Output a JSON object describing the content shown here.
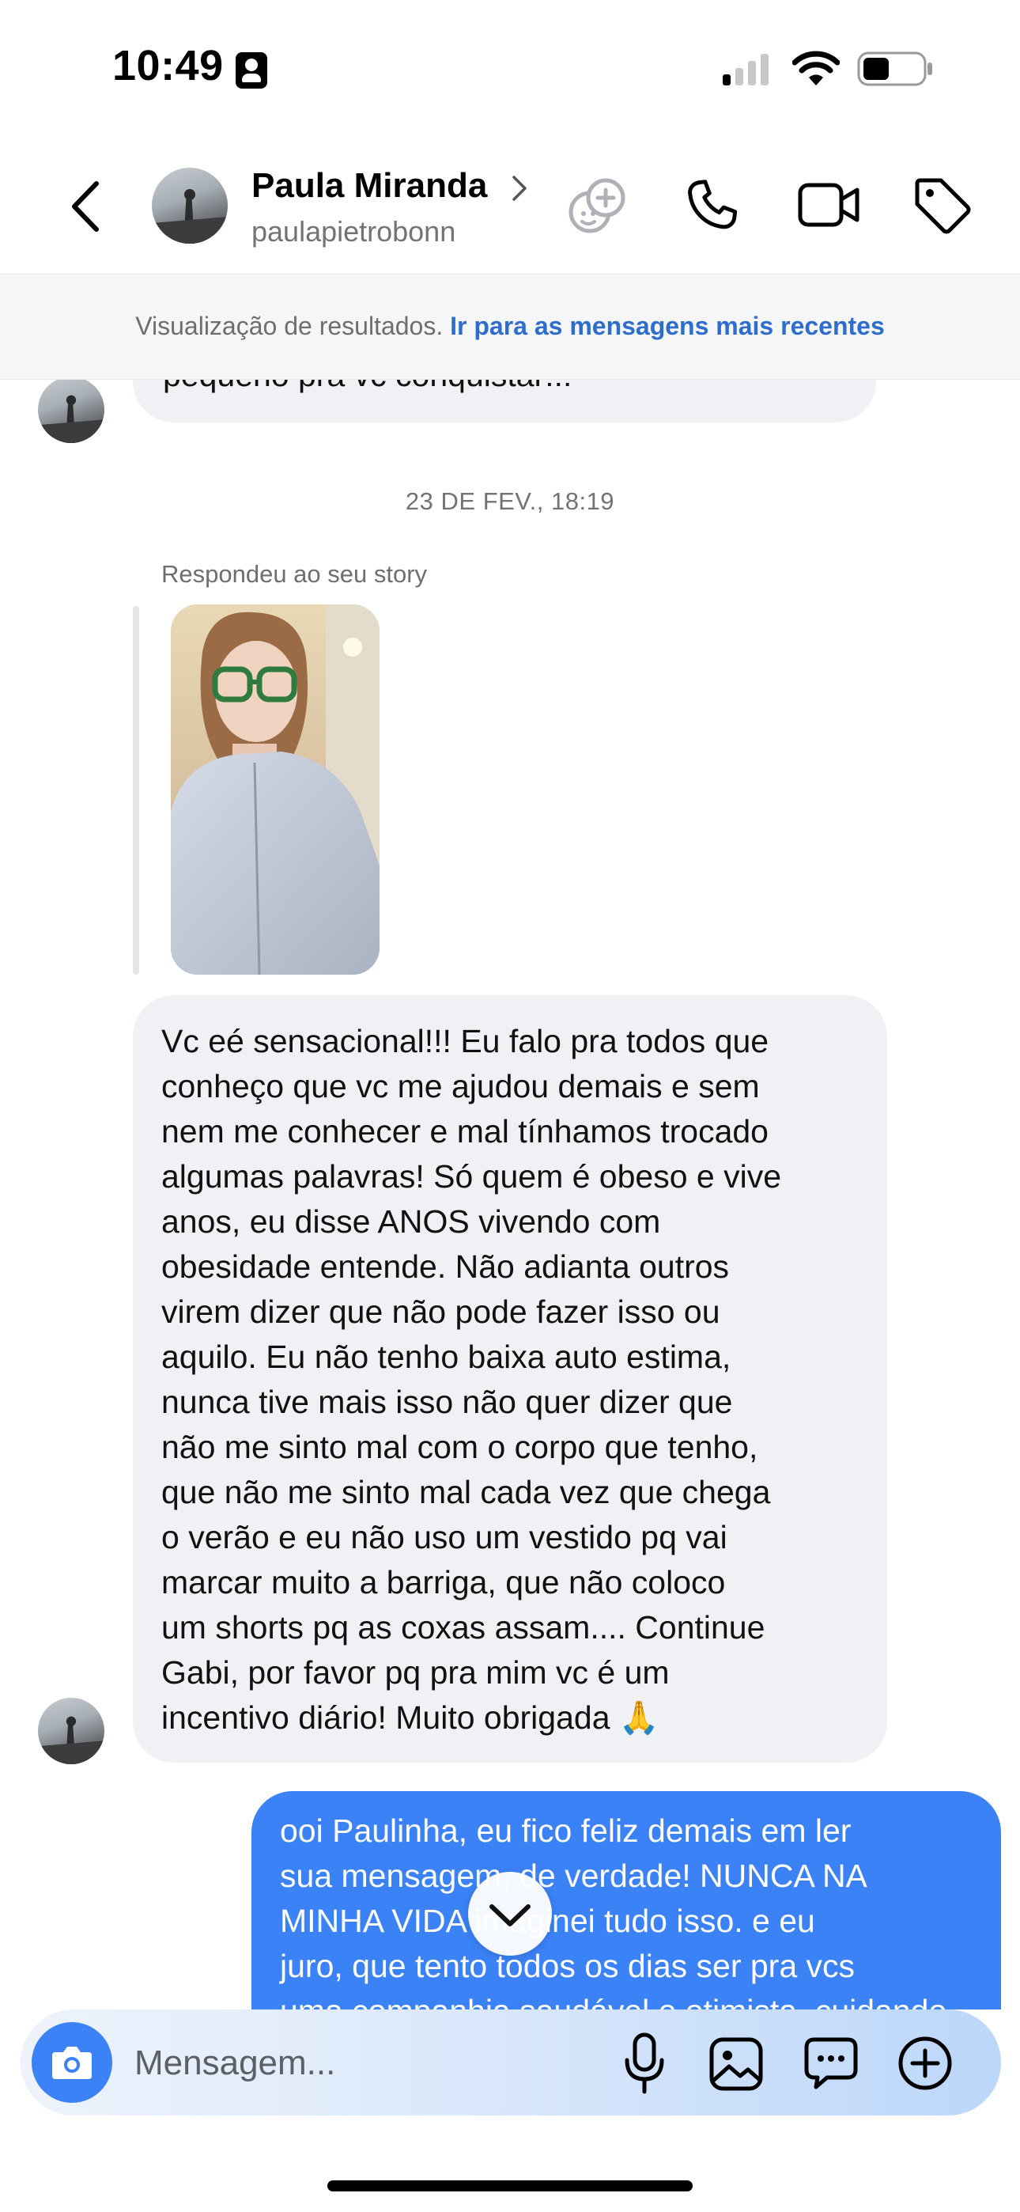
{
  "status_bar": {
    "time": "10:49"
  },
  "header": {
    "name": "Paula Miranda",
    "username": "paulapietrobonn",
    "icons": [
      "back-chevron-icon",
      "chevron-right-icon",
      "sticker-add-icon",
      "phone-icon",
      "video-camera-icon",
      "tag-icon"
    ]
  },
  "banner": {
    "muted": "Visualização de resultados. ",
    "link": "Ir para as mensagens mais recentes"
  },
  "messages": {
    "partial_top": "pequeno pra vc conquistar!!!",
    "date": "23 DE FEV., 18:19",
    "reply_label": "Respondeu ao seu story",
    "received_lines": [
      "Vc eé sensacional!!! Eu falo pra todos que",
      "conheço que vc me ajudou demais e sem",
      "nem me conhecer e mal tínhamos trocado",
      "algumas palavras! Só quem é obeso e vive",
      "anos, eu disse ANOS vivendo com",
      "obesidade entende. Não adianta outros",
      "virem dizer que não pode fazer isso ou",
      "aquilo. Eu não tenho baixa auto estima,",
      "nunca tive mais isso não quer dizer que",
      "não me sinto mal com o corpo que tenho,",
      "que não me sinto mal cada vez que chega",
      "o verão e eu não uso um vestido pq vai",
      "marcar muito a barriga, que não coloco",
      "um shorts pq as coxas assam.... Continue",
      "Gabi, por favor pq pra mim vc é um",
      "incentivo diário! Muito obrigada 🙏"
    ],
    "sent_lines": [
      "ooi Paulinha, eu fico feliz demais em ler",
      "sua mensagem, de verdade! NUNCA NA",
      "MINHA VIDA imaginei tudo isso. e eu",
      "juro, que tento todos os dias ser pra vcs",
      "uma companhia saudável e otimista, cuidando"
    ]
  },
  "composer": {
    "placeholder": "Mensagem...",
    "icons": [
      "camera-icon",
      "microphone-icon",
      "gallery-icon",
      "sticker-message-icon",
      "plus-circle-icon"
    ]
  },
  "colors": {
    "sent_bubble": "#3b82f6",
    "received_bubble": "#f0f1f4",
    "link": "#2e6dcc"
  }
}
